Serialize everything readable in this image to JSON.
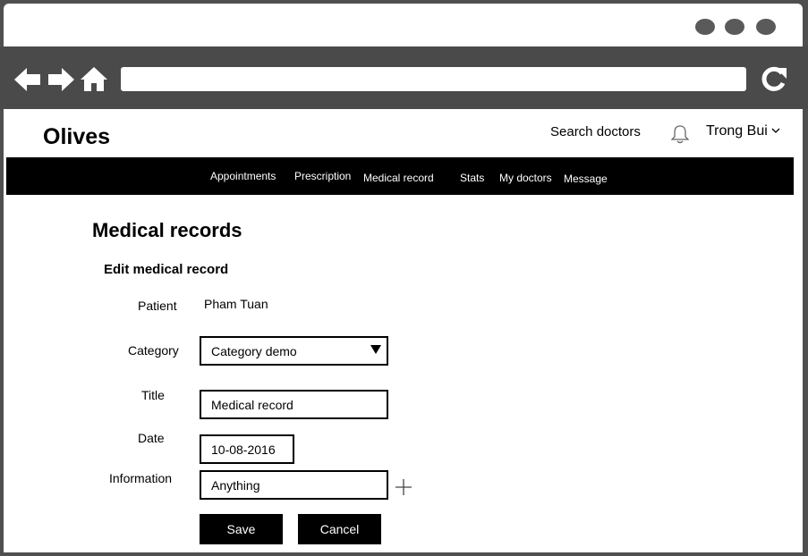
{
  "app": {
    "brand": "Olives",
    "search_link": "Search doctors",
    "user_name": "Trong Bui"
  },
  "nav": {
    "items": [
      {
        "label": "Appointments"
      },
      {
        "label": "Prescription"
      },
      {
        "label": "Medical record"
      },
      {
        "label": "Stats"
      },
      {
        "label": "My doctors"
      },
      {
        "label": "Message"
      }
    ]
  },
  "page": {
    "title": "Medical records",
    "subtitle": "Edit medical record"
  },
  "form": {
    "patient_label": "Patient",
    "patient_value": "Pham Tuan",
    "category_label": "Category",
    "category_value": "Category demo",
    "title_label": "Title",
    "title_value": "Medical record",
    "date_label": "Date",
    "date_value": "10-08-2016",
    "information_label": "Information",
    "information_value": "Anything",
    "save_label": "Save",
    "cancel_label": "Cancel"
  },
  "icons": {
    "back": "arrow-left-icon",
    "forward": "arrow-right-icon",
    "home": "home-icon",
    "reload": "reload-icon",
    "notifications": "bell-icon",
    "user_menu": "chevron-down-icon",
    "add": "plus-icon"
  },
  "colors": {
    "frame": "#4f4f4f",
    "menubar": "#000000",
    "button": "#000000"
  }
}
